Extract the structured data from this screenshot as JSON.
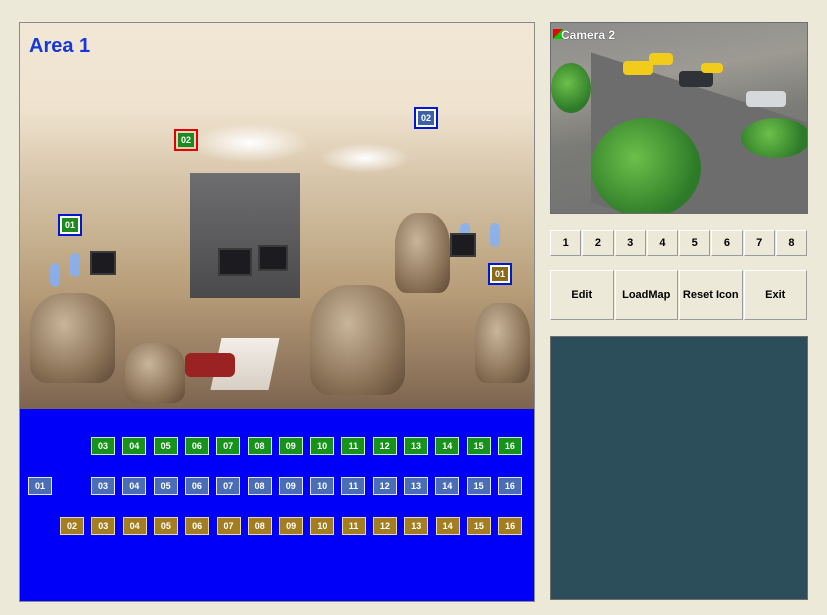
{
  "map": {
    "title": "Area 1",
    "photo_cameras": [
      {
        "label": "02",
        "style": "red",
        "color": "g"
      },
      {
        "label": "02",
        "style": "blue",
        "color": "b"
      },
      {
        "label": "01",
        "style": "blue",
        "color": "g"
      },
      {
        "label": "01",
        "style": "blue",
        "color": "y"
      }
    ],
    "icon_rows": {
      "green": [
        "03",
        "04",
        "05",
        "06",
        "07",
        "08",
        "09",
        "10",
        "11",
        "12",
        "13",
        "14",
        "15",
        "16"
      ],
      "blue": [
        "01",
        "03",
        "04",
        "05",
        "06",
        "07",
        "08",
        "09",
        "10",
        "11",
        "12",
        "13",
        "14",
        "15",
        "16"
      ],
      "gold": [
        "02",
        "03",
        "04",
        "05",
        "06",
        "07",
        "08",
        "09",
        "10",
        "11",
        "12",
        "13",
        "14",
        "15",
        "16"
      ]
    }
  },
  "video": {
    "camera_label": "Camera 2"
  },
  "channel_buttons": [
    "1",
    "2",
    "3",
    "4",
    "5",
    "6",
    "7",
    "8"
  ],
  "actions": {
    "edit": "Edit",
    "load_map": "LoadMap",
    "reset_icon": "Reset Icon",
    "exit": "Exit"
  },
  "colors": {
    "map_bg": "#0000f8",
    "info_panel": "#2c4e5a",
    "title": "#1637d9"
  }
}
